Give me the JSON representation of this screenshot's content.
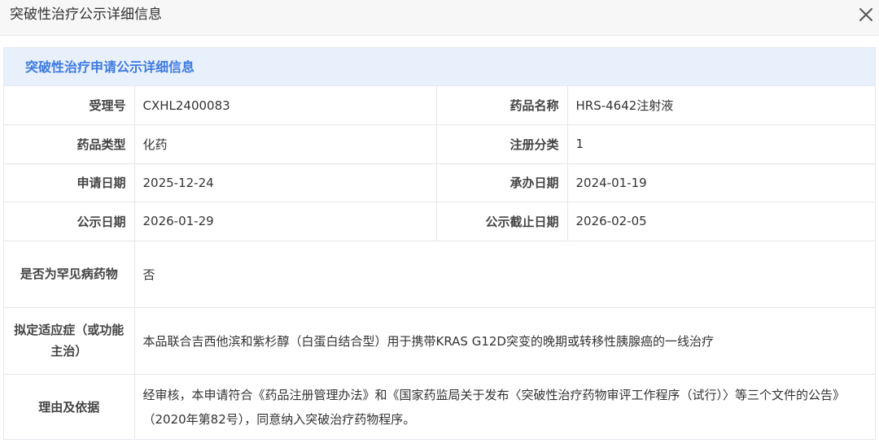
{
  "window": {
    "title": "突破性治疗公示详细信息",
    "close_icon": "close-icon"
  },
  "panel": {
    "heading": "突破性治疗申请公示详细信息",
    "accent_color": "#3d7ae0",
    "heading_bg": "#e8f0fb"
  },
  "fields": {
    "acceptance_no": {
      "label": "受理号",
      "value": "CXHL2400083"
    },
    "drug_name": {
      "label": "药品名称",
      "value": "HRS-4642注射液"
    },
    "drug_type": {
      "label": "药品类型",
      "value": "化药"
    },
    "registration_class": {
      "label": "注册分类",
      "value": "1"
    },
    "application_date": {
      "label": "申请日期",
      "value": "2025-12-24"
    },
    "undertaking_date": {
      "label": "承办日期",
      "value": "2024-01-19"
    },
    "publicity_date": {
      "label": "公示日期",
      "value": "2026-01-29"
    },
    "publicity_deadline": {
      "label": "公示截止日期",
      "value": "2026-02-05"
    },
    "rare_disease": {
      "label": "是否为罕见病药物",
      "value": "否"
    },
    "indication": {
      "label": "拟定适应症（或功能主治）",
      "value": "本品联合吉西他滨和紫杉醇（白蛋白结合型）用于携带KRAS G12D突变的晚期或转移性胰腺癌的一线治疗"
    },
    "reason": {
      "label": "理由及依据",
      "value": "经审核，本申请符合《药品注册管理办法》和《国家药监局关于发布〈突破性治疗药物审评工作程序（试行）〉等三个文件的公告》（2020年第82号），同意纳入突破治疗药物程序。"
    }
  }
}
